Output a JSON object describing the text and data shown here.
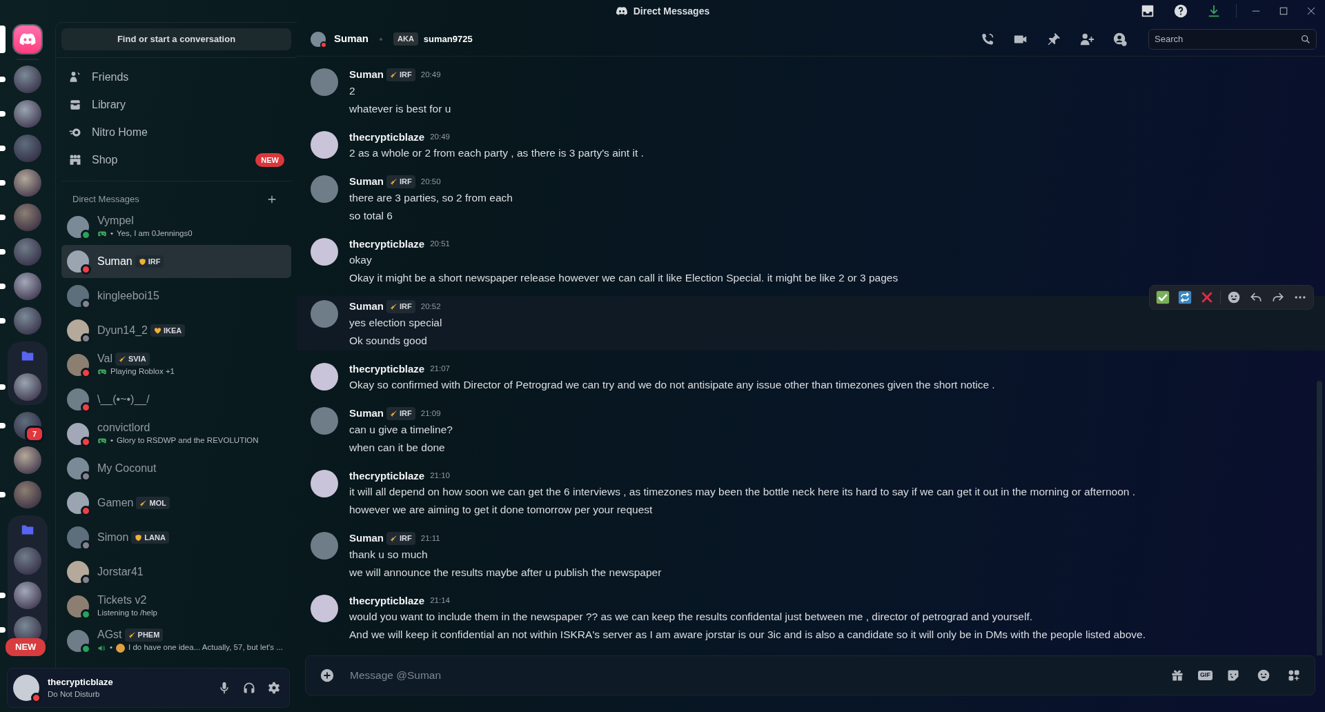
{
  "window": {
    "title": "Direct Messages"
  },
  "servers": [
    {
      "kind": "home",
      "selected": true,
      "unread": false
    },
    {
      "kind": "server",
      "selected": false,
      "unread": true
    },
    {
      "kind": "server",
      "selected": false,
      "unread": true
    },
    {
      "kind": "server",
      "selected": false,
      "unread": true
    },
    {
      "kind": "server",
      "selected": false,
      "unread": true
    },
    {
      "kind": "server",
      "selected": false,
      "unread": true
    },
    {
      "kind": "server",
      "selected": false,
      "unread": true
    },
    {
      "kind": "server",
      "selected": false,
      "unread": true
    },
    {
      "kind": "server",
      "selected": false,
      "unread": true
    },
    {
      "kind": "folder",
      "children": [
        {
          "kind": "server",
          "selected": false,
          "unread": true
        }
      ]
    },
    {
      "kind": "server",
      "selected": false,
      "unread": true,
      "badge": "7"
    },
    {
      "kind": "server",
      "selected": false,
      "unread": false
    },
    {
      "kind": "server",
      "selected": false,
      "unread": true
    },
    {
      "kind": "folder",
      "children": [
        {
          "kind": "server",
          "selected": false,
          "unread": false
        },
        {
          "kind": "server",
          "selected": false,
          "unread": true
        },
        {
          "kind": "server",
          "selected": false,
          "unread": true
        }
      ]
    }
  ],
  "rail_new_pill": "NEW",
  "find_button": "Find or start a conversation",
  "nav": [
    {
      "kind": "friends",
      "label": "Friends"
    },
    {
      "kind": "library",
      "label": "Library"
    },
    {
      "kind": "nitro",
      "label": "Nitro Home"
    },
    {
      "kind": "shop",
      "label": "Shop",
      "badge": "NEW"
    }
  ],
  "dm_header": "Direct Messages",
  "dms": [
    {
      "name": "Vympel",
      "color": "#23a55a",
      "selected": false,
      "activity": {
        "kind": "game",
        "separator": "•",
        "emoji": false,
        "text": "Yes, I am 0Jennings0"
      }
    },
    {
      "name": "Suman",
      "tag": "IRF",
      "color": "#f23f43",
      "selected": true
    },
    {
      "name": "kingleeboi15",
      "color": "#80848e",
      "selected": false
    },
    {
      "name": "Dyun14_2",
      "tag": "IKEA",
      "color": "#80848e",
      "selected": false
    },
    {
      "name": "Val",
      "tag": "SVIA",
      "color": "#f23f43",
      "selected": false,
      "activity": {
        "kind": "game",
        "emoji": false,
        "text": "Playing Roblox +1"
      }
    },
    {
      "name": "\\__(•~•)__/",
      "color": "#f23f43",
      "selected": false
    },
    {
      "name": "convictlord",
      "color": "#f23f43",
      "selected": false,
      "activity": {
        "kind": "game",
        "separator": "•",
        "emoji": false,
        "text": "Glory to RSDWP and the REVOLUTION"
      }
    },
    {
      "name": "My Coconut",
      "color": "#80848e",
      "selected": false
    },
    {
      "name": "Gamen",
      "tag": "MOL",
      "color": "#f23f43",
      "selected": false
    },
    {
      "name": "Simon",
      "tag": "LANA",
      "color": "#80848e",
      "selected": false
    },
    {
      "name": "Jorstar41",
      "color": "#80848e",
      "selected": false
    },
    {
      "name": "Tickets v2",
      "color": "#23a55a",
      "selected": false,
      "activity": {
        "kind": "text",
        "emoji": false,
        "text": "Listening to /help"
      }
    },
    {
      "name": "AGst",
      "tag": "PHEM",
      "color": "#23a55a",
      "selected": false,
      "activity": {
        "kind": "voice",
        "separator": "•",
        "emoji": true,
        "text": "I do have one idea... Actually, 57, but let's ..."
      }
    }
  ],
  "user_panel": {
    "name": "thecrypticblaze",
    "status_text": "Do Not Disturb",
    "color": "#f23f43"
  },
  "chat_header": {
    "name": "Suman",
    "color": "#f23f43",
    "aka": "AKA",
    "username": "suman9725",
    "search_placeholder": "Search"
  },
  "messages": [
    {
      "author": "Suman",
      "tag": "IRF",
      "time": "20:49",
      "hovered": false,
      "lines": [
        "2",
        "whatever is best for u"
      ]
    },
    {
      "author": "thecrypticblaze",
      "time": "20:49",
      "hovered": false,
      "lines": [
        "2 as a whole or 2 from each party , as there is 3 party's aint it ."
      ]
    },
    {
      "author": "Suman",
      "tag": "IRF",
      "time": "20:50",
      "hovered": false,
      "lines": [
        "there are 3 parties, so 2 from each",
        "so total 6"
      ]
    },
    {
      "author": "thecrypticblaze",
      "time": "20:51",
      "hovered": false,
      "lines": [
        "okay",
        "Okay it might be a short newspaper release however we can call it like Election Special. it might be like 2 or 3 pages"
      ]
    },
    {
      "author": "Suman",
      "tag": "IRF",
      "time": "20:52",
      "hovered": true,
      "lines": [
        "yes election special",
        "Ok sounds good"
      ]
    },
    {
      "author": "thecrypticblaze",
      "time": "21:07",
      "hovered": false,
      "lines": [
        "Okay so confirmed with Director of Petrograd we can try and we do not antisipate any issue other than timezones given the short notice ."
      ]
    },
    {
      "author": "Suman",
      "tag": "IRF",
      "time": "21:09",
      "hovered": false,
      "lines": [
        "can u give a timeline?",
        "when can it be done"
      ]
    },
    {
      "author": "thecrypticblaze",
      "time": "21:10",
      "hovered": false,
      "lines": [
        "it will all depend on how soon we can get the 6 interviews , as timezones may been the bottle neck here its hard to say if we can get it out in the morning or afternoon .",
        "however we are aiming to get it done tomorrow per your request"
      ]
    },
    {
      "author": "Suman",
      "tag": "IRF",
      "time": "21:11",
      "hovered": false,
      "lines": [
        "thank u so much",
        "we will announce the results maybe after u publish the newspaper"
      ]
    },
    {
      "author": "thecrypticblaze",
      "time": "21:14",
      "hovered": false,
      "lines": [
        "would you want to include them in the newspaper ?? as we can keep the results confidental just between me , director of petrograd and yourself.",
        "And we will keep it confidential an not within ISKRA's server as I am aware jorstar is our 3ic and is also a candidate so it will only be in DMs with the people listed above."
      ]
    }
  ],
  "composer": {
    "placeholder": "Message @Suman",
    "gif_label": "GIF"
  }
}
